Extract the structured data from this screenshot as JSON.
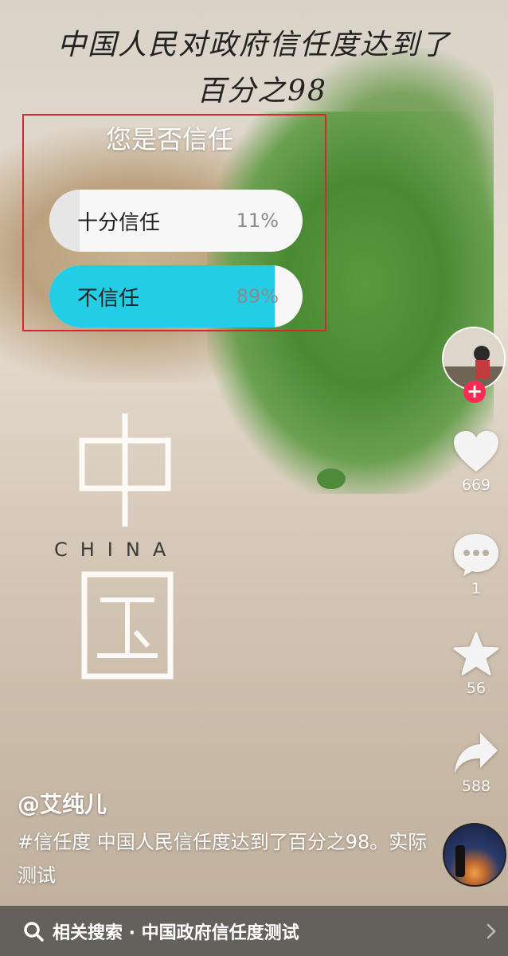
{
  "title": {
    "line1": "中国人民对政府信任度达到了",
    "line2": "百分之98"
  },
  "poll": {
    "question": "您是否信任",
    "options": [
      {
        "label": "十分信任",
        "percent": "11%",
        "value": 11
      },
      {
        "label": "不信任",
        "percent": "89%",
        "value": 89
      }
    ]
  },
  "poster": {
    "china_label": "CHINA"
  },
  "sidebar": {
    "like_count": "669",
    "comment_count": "1",
    "favorite_count": "56",
    "share_count": "588"
  },
  "post": {
    "author": "@艾纯儿",
    "description": "#信任度 中国人民信任度达到了百分之98。实际测试"
  },
  "search": {
    "text": "相关搜索 · 中国政府信任度测试"
  },
  "colors": {
    "poll_fill": "#23cde6",
    "follow_plus": "#fe2c55",
    "annotation_box": "#d8262e"
  },
  "icons": [
    "heart-icon",
    "comment-icon",
    "star-icon",
    "share-icon",
    "search-icon",
    "chevron-right-icon",
    "plus-icon"
  ]
}
